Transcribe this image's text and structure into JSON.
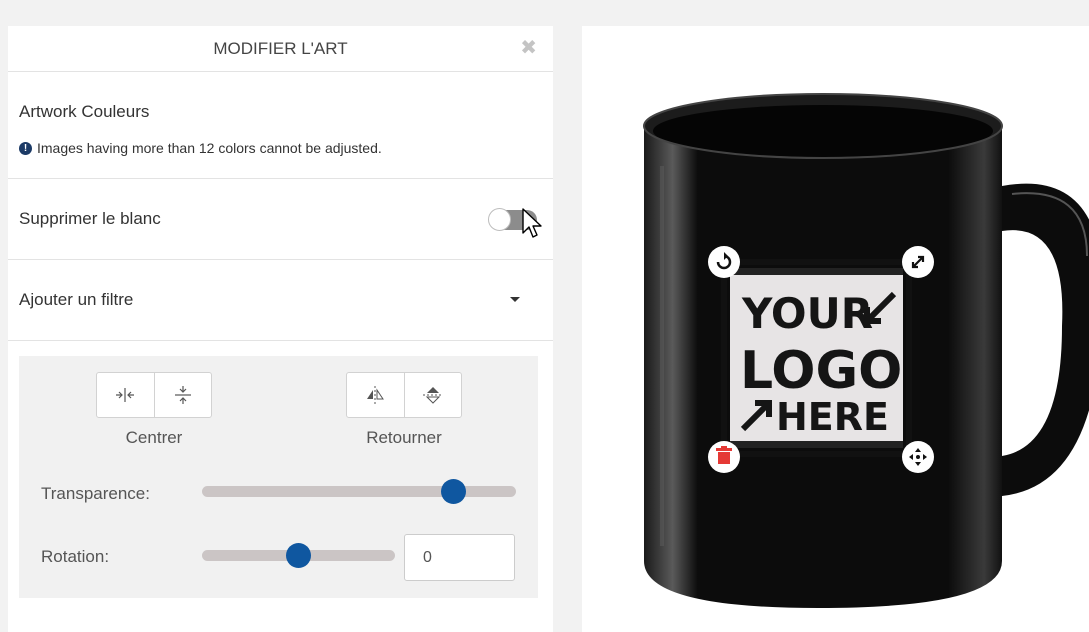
{
  "panel": {
    "title": "MODIFIER L'ART",
    "close_icon": "close-icon",
    "artwork_colors_title": "Artwork Couleurs",
    "artwork_colors_info": "Images having more than 12 colors cannot be adjusted.",
    "remove_white_label": "Supprimer le blanc",
    "remove_white_enabled": false,
    "add_filter_label": "Ajouter un filtre"
  },
  "tools": {
    "center_label": "Centrer",
    "center_icons": [
      "center-horizontal-icon",
      "center-vertical-icon"
    ],
    "flip_label": "Retourner",
    "flip_icons": [
      "flip-horizontal-icon",
      "flip-vertical-icon"
    ],
    "transparency_label": "Transparence:",
    "transparency_value": 0.8,
    "rotation_label": "Rotation:",
    "rotation_slider_value": 0.5,
    "rotation_value": "0"
  },
  "preview": {
    "mug_color": "#0c0c0c",
    "logo_lines": [
      "YOUR",
      "LOGO",
      "HERE"
    ],
    "handles": [
      "rotate-icon",
      "resize-icon",
      "delete-icon",
      "move-icon"
    ],
    "delete_color": "#e53935"
  }
}
